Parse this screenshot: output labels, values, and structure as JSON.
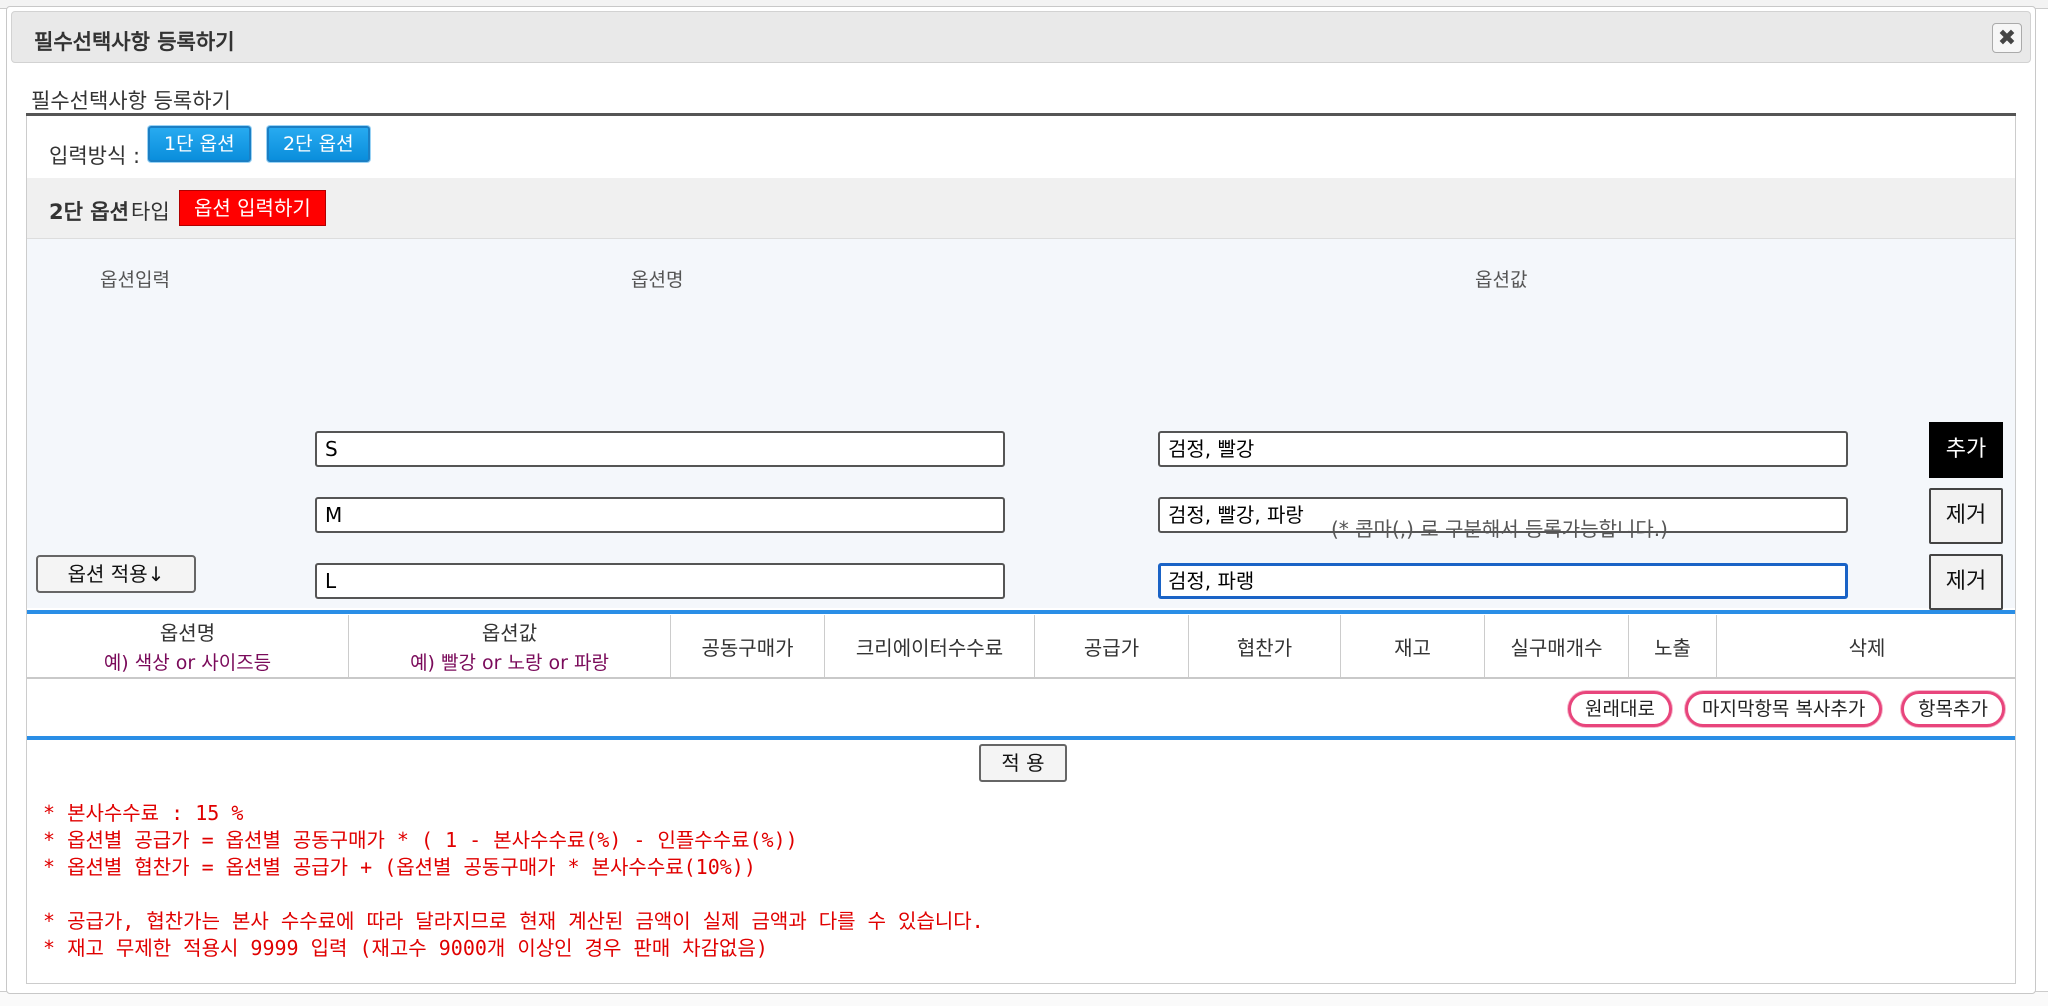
{
  "dialog": {
    "title": "필수선택사항 등록하기",
    "close_icon": "close-icon",
    "subtitle": "필수선택사항 등록하기"
  },
  "input_method": {
    "label": "입력방식 :",
    "btn_one_level": "1단 옵션",
    "btn_two_level": "2단 옵션"
  },
  "type_row": {
    "type_bold": "2단 옵션",
    "type_suffix": "타입",
    "btn_input": "옵션 입력하기"
  },
  "option_form": {
    "headers": {
      "input": "옵션입력",
      "name": "옵션명",
      "value": "옵션값"
    },
    "rows": [
      {
        "name": "S",
        "value": "검정, 빨강",
        "action": "추가"
      },
      {
        "name": "M",
        "value": "검정, 빨강, 파랑",
        "action": "제거"
      },
      {
        "name": "L",
        "value": "검정, 파랭",
        "action": "제거"
      }
    ],
    "hint": "(* 콤마(,) 로 구분해서 등록가능합니다.)",
    "apply_button": "옵션 적용↓"
  },
  "table": {
    "columns": [
      {
        "label": "옵션명",
        "example": "예) 색상 or 사이즈등"
      },
      {
        "label": "옵션값",
        "example": "예) 빨강 or 노랑 or 파랑"
      },
      {
        "label": "공동구매가",
        "example": ""
      },
      {
        "label": "크리에이터수수료",
        "example": ""
      },
      {
        "label": "공급가",
        "example": ""
      },
      {
        "label": "협찬가",
        "example": ""
      },
      {
        "label": "재고",
        "example": ""
      },
      {
        "label": "실구매개수",
        "example": ""
      },
      {
        "label": "노출",
        "example": ""
      },
      {
        "label": "삭제",
        "example": ""
      }
    ]
  },
  "row_actions": {
    "reset": "원래대로",
    "copy_last": "마지막항목 복사추가",
    "add_item": "항목추가"
  },
  "apply": "적 용",
  "notes": [
    "* 본사수수료 : 15 %",
    "* 옵션별 공급가 = 옵션별 공동구매가 * ( 1 - 본사수수료(%) - 인플수수료(%))",
    "* 옵션별 협찬가 = 옵션별 공급가 + (옵션별 공동구매가 * 본사수수료(10%))",
    "* 공급가, 협찬가는 본사 수수료에 따라 달라지므로 현재 계산된 금액이 실제 금액과 다를 수 있습니다.",
    "* 재고 무제한 적용시 9999 입력 (재고수 9000개 이상인 경우 판매 차감없음)"
  ],
  "colors": {
    "accent_blue": "#0a8edc",
    "accent_red": "#ff0000",
    "note_red": "#e00000",
    "pill_pink": "#e8457c"
  }
}
